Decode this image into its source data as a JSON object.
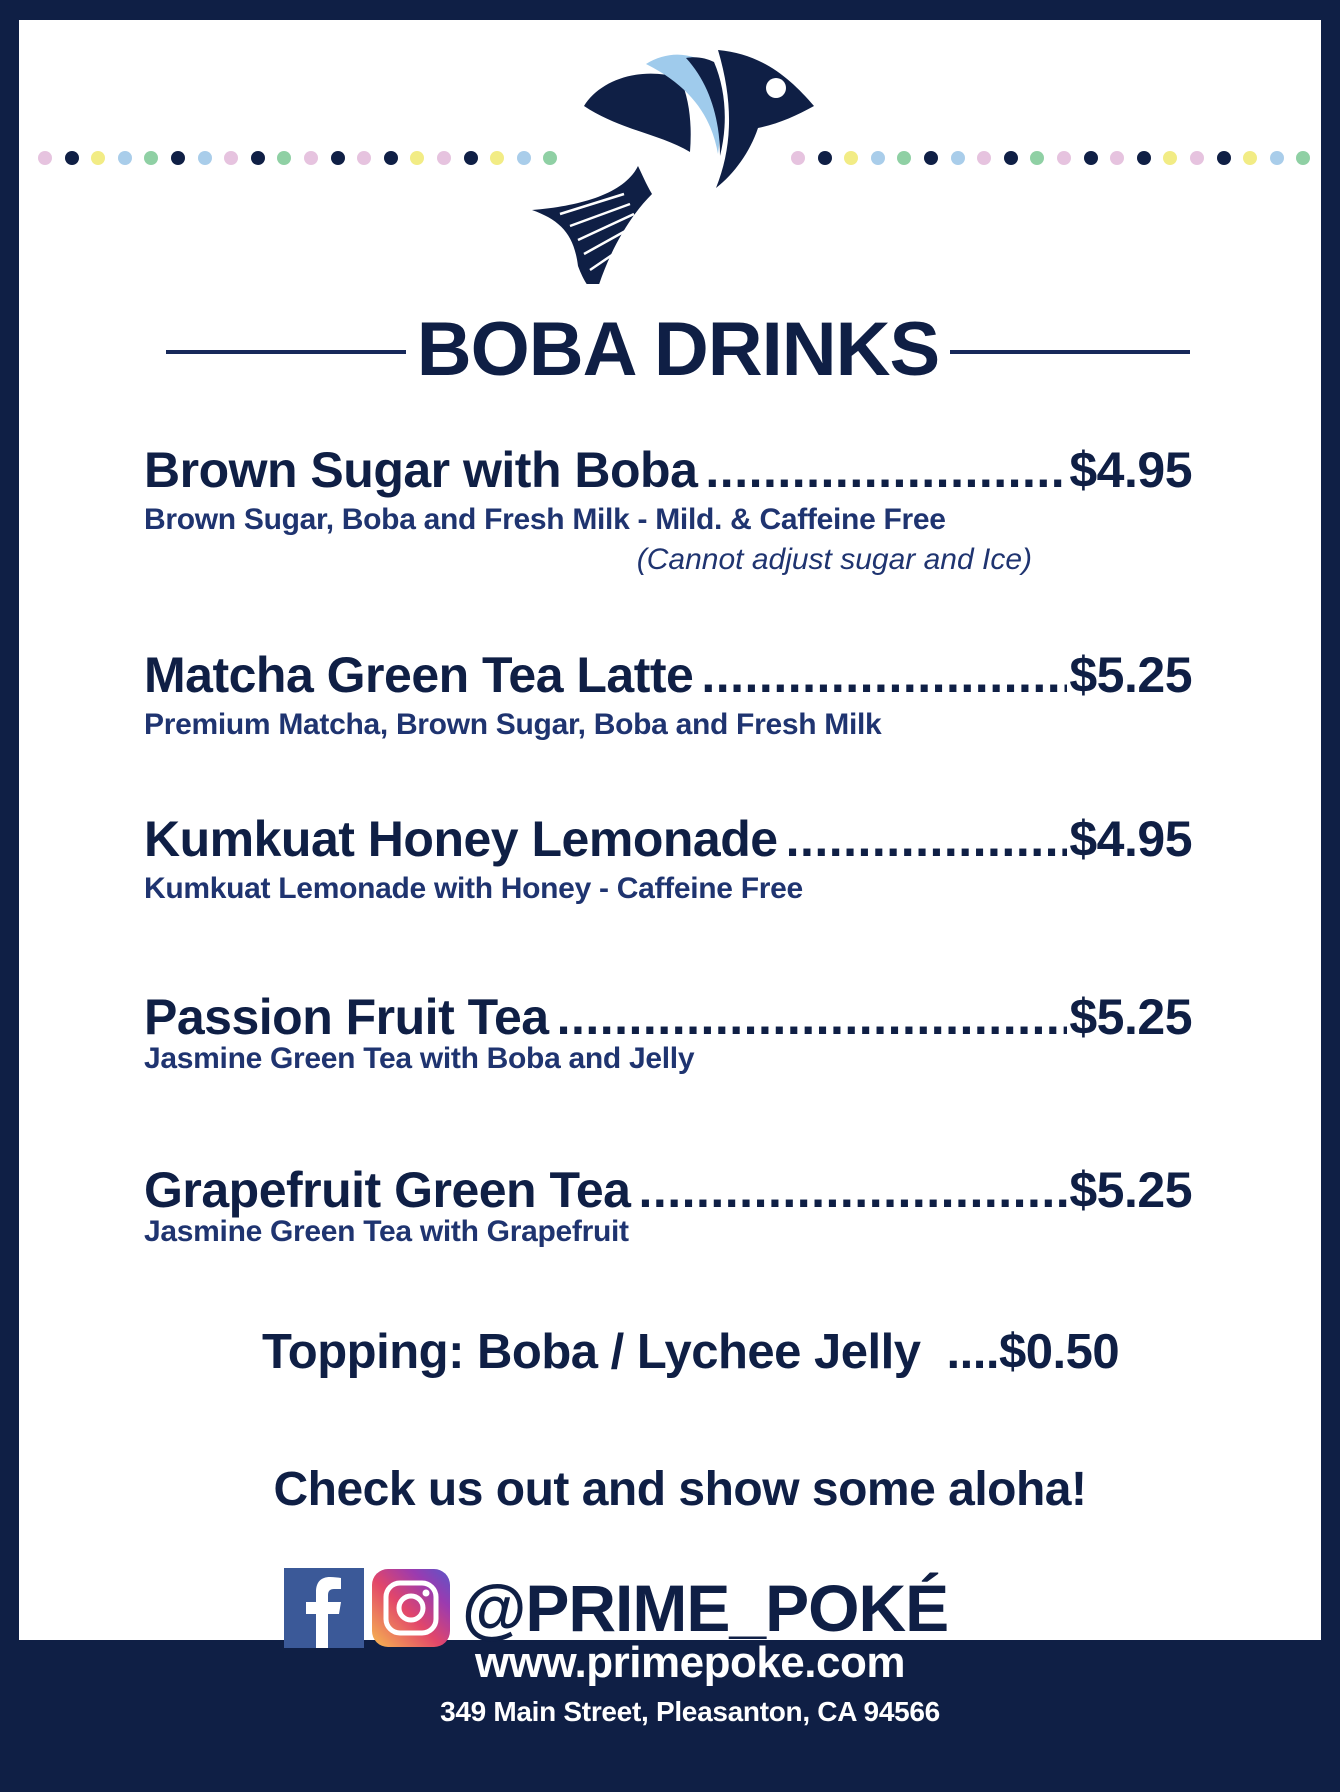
{
  "colors": {
    "navy": "#0f1f45",
    "text_blue": "#1f3470",
    "dot_pink": "#e6c3df",
    "dot_navy": "#0f1f45",
    "dot_yellow": "#f2ec85",
    "dot_blue": "#a9cdea",
    "dot_green": "#8fd0a4",
    "fish_light_blue": "#9fcbec"
  },
  "dot_pattern": [
    "dot_pink",
    "dot_navy",
    "dot_yellow",
    "dot_blue",
    "dot_green",
    "dot_navy",
    "dot_blue",
    "dot_pink",
    "dot_navy",
    "dot_green",
    "dot_pink",
    "dot_navy",
    "dot_pink",
    "dot_navy",
    "dot_yellow",
    "dot_pink",
    "dot_navy",
    "dot_yellow",
    "dot_blue",
    "dot_green"
  ],
  "logo": {
    "icon": "fish-logo-icon"
  },
  "heading": "BOBA DRINKS",
  "items": [
    {
      "name": "Brown Sugar with Boba",
      "price": "$4.95",
      "description": "Brown Sugar, Boba and Fresh Milk -  Mild. & Caffeine Free",
      "note": "(Cannot adjust sugar and Ice)"
    },
    {
      "name": "Matcha Green Tea Latte",
      "price": "$5.25",
      "description": "Premium Matcha, Brown Sugar, Boba and Fresh Milk"
    },
    {
      "name": "Kumkuat Honey Lemonade",
      "price": "$4.95",
      "description": "Kumkuat Lemonade with Honey - Caffeine Free"
    },
    {
      "name": "Passion Fruit Tea",
      "price": "$5.25",
      "description": "Jasmine Green Tea with Boba and Jelly"
    },
    {
      "name": "Grapefruit Green Tea",
      "price": "$5.25",
      "description": "Jasmine Green Tea with Grapefruit"
    }
  ],
  "topping": {
    "label": "Topping: Boba / Lychee Jelly",
    "price": "$0.50"
  },
  "tagline": "Check us out and show some aloha!",
  "social": {
    "facebook_icon": "facebook-icon",
    "instagram_icon": "instagram-icon",
    "handle": "@PRIME_POKÉ"
  },
  "website": "www.primepoke.com",
  "address": "349 Main Street, Pleasanton, CA 94566"
}
